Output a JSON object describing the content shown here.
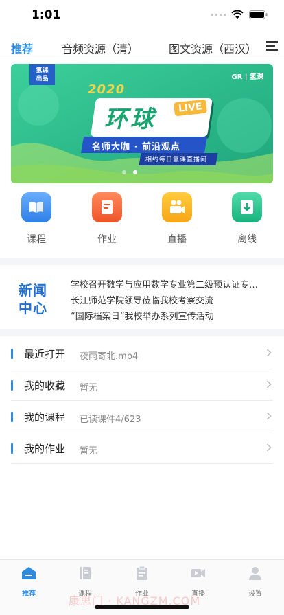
{
  "status_bar": {
    "time": "1:01"
  },
  "top_nav": {
    "tabs": [
      {
        "label": "推荐",
        "active": true
      },
      {
        "label": "音频资源（清）",
        "active": false
      },
      {
        "label": "图文资源（西汉）",
        "active": false
      }
    ],
    "menu_icon": "hamburger-menu-icon"
  },
  "banner": {
    "badge": "氢课\n出品",
    "logo": "GR | 氢课",
    "year": "2020",
    "title": "环球",
    "live": "LIVE",
    "subtitle": "名师大咖 · 前沿观点",
    "subtitle2": "相约每日氢课直播间",
    "colors": {
      "bg": "#27b98a",
      "accent": "#f6b93b"
    },
    "slides": 2,
    "active_slide": 2
  },
  "quick_actions": [
    {
      "label": "课程",
      "icon": "book-icon",
      "color": "#3f8ef3"
    },
    {
      "label": "作业",
      "icon": "homework-icon",
      "color": "#f36b3b"
    },
    {
      "label": "直播",
      "icon": "live-camera-icon",
      "color": "#f9b724"
    },
    {
      "label": "离线",
      "icon": "download-icon",
      "color": "#2dc493"
    }
  ],
  "news": {
    "logo_line1": "新闻",
    "logo_line2": "中心",
    "items": [
      "学校召开数学与应用数学专业第二级预认证专…",
      "长江师范学院领导莅临我校考察交流",
      "“国际档案日”我校举办系列宣传活动"
    ]
  },
  "list": [
    {
      "title": "最近打开",
      "value": "夜雨寄北.mp4"
    },
    {
      "title": "我的收藏",
      "value": "暂无"
    },
    {
      "title": "我的课程",
      "value": "已读课件4/623"
    },
    {
      "title": "我的作业",
      "value": "暂无"
    }
  ],
  "tabbar": [
    {
      "label": "推荐",
      "icon": "home-icon",
      "active": true
    },
    {
      "label": "课程",
      "icon": "course-icon",
      "active": false
    },
    {
      "label": "作业",
      "icon": "clipboard-icon",
      "active": false
    },
    {
      "label": "直播",
      "icon": "video-icon",
      "active": false
    },
    {
      "label": "设置",
      "icon": "person-icon",
      "active": false
    }
  ],
  "watermark": "康思门 · KANGZM.COM",
  "colors": {
    "accent": "#2d8ce0"
  }
}
